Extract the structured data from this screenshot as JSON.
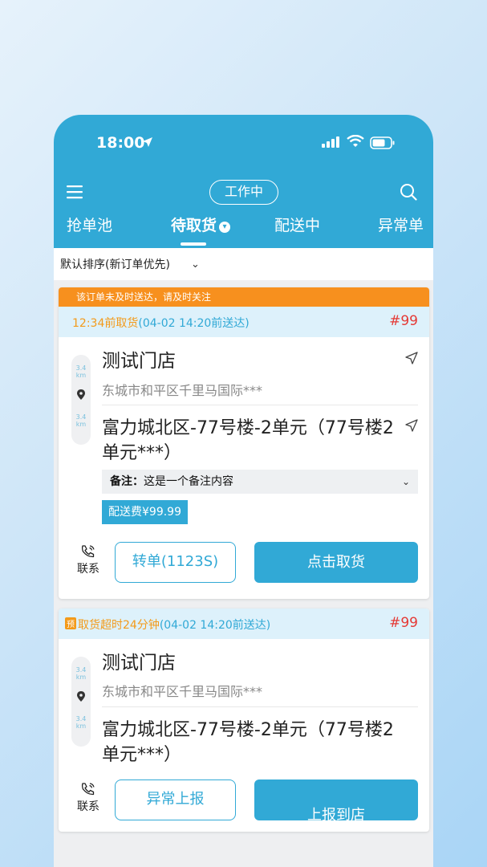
{
  "status": {
    "time": "18:00"
  },
  "header": {
    "work_status": "工作中",
    "tabs": [
      {
        "label": "抢单池"
      },
      {
        "label": "待取货",
        "active": true
      },
      {
        "label": "配送中"
      },
      {
        "label": "异常单"
      }
    ]
  },
  "sort": {
    "label": "默认排序(新订单优先)"
  },
  "orders": [
    {
      "warning": "该订单未及时送达，请及时关注",
      "pickup_time": "12:34前取货",
      "deliver_by": "(04-02 14:20前送达)",
      "number": "#99",
      "dist_top": "3.4",
      "dist_unit": "km",
      "dist_bottom": "3.4",
      "store_name": "测试门店",
      "store_address": "东城市和平区千里马国际***",
      "destination": "富力城北区-77号楼-2单元（77号楼2单元***）",
      "note_label": "备注：",
      "note_text": "这是一个备注内容",
      "fee": "配送费¥99.99",
      "contact": "联系",
      "secondary_button": "转单(1123S)",
      "primary_button": "点击取货"
    },
    {
      "badge": "预",
      "overdue": "取货超时24分钟",
      "deliver_by": "(04-02 14:20前送达)",
      "number": "#99",
      "dist_top": "3.4",
      "dist_unit": "km",
      "dist_bottom": "3.4",
      "store_name": "测试门店",
      "store_address": "东城市和平区千里马国际***",
      "destination": "富力城北区-77号楼-2单元（77号楼2单元***）",
      "contact": "联系",
      "secondary_button": "异常上报",
      "primary_button": "上报到店"
    }
  ]
}
